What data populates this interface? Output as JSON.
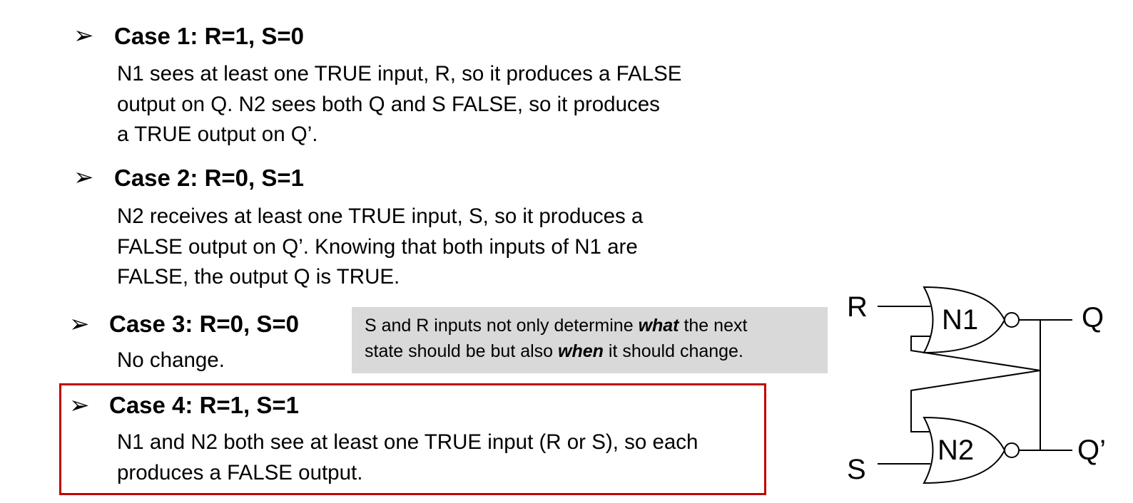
{
  "bullet_symbol": "➢",
  "cases": [
    {
      "title": "Case 1: R=1, S=0",
      "lines": [
        "N1 sees at least one TRUE input, R, so it produces a FALSE",
        "output on Q. N2 sees both Q and S FALSE, so it produces",
        "a TRUE output on Q’."
      ]
    },
    {
      "title": "Case 2: R=0, S=1",
      "lines": [
        "N2 receives at least one TRUE input, S, so it produces a",
        "FALSE output on Q’. Knowing that both inputs of N1 are",
        "FALSE, the output Q is TRUE."
      ]
    },
    {
      "title": "Case 3: R=0, S=0",
      "lines": [
        "No change."
      ]
    },
    {
      "title": "Case 4: R=1, S=1",
      "lines": [
        "N1 and N2 both see at least one TRUE input (R or S), so each",
        "produces a FALSE output."
      ]
    }
  ],
  "note": {
    "line1_before": "S and R inputs not only determine ",
    "line1_emphasis": "what",
    "line1_after": " the next",
    "line2_before": "state should be but also ",
    "line2_emphasis": "when",
    "line2_after": " it should change."
  },
  "circuit": {
    "input_top": "R",
    "input_bottom": "S",
    "gate_top": "N1",
    "gate_bottom": "N2",
    "output_top": "Q",
    "output_bottom": "Q’"
  },
  "colors": {
    "highlight_border": "#c00000",
    "note_background": "#d9d9d9"
  }
}
